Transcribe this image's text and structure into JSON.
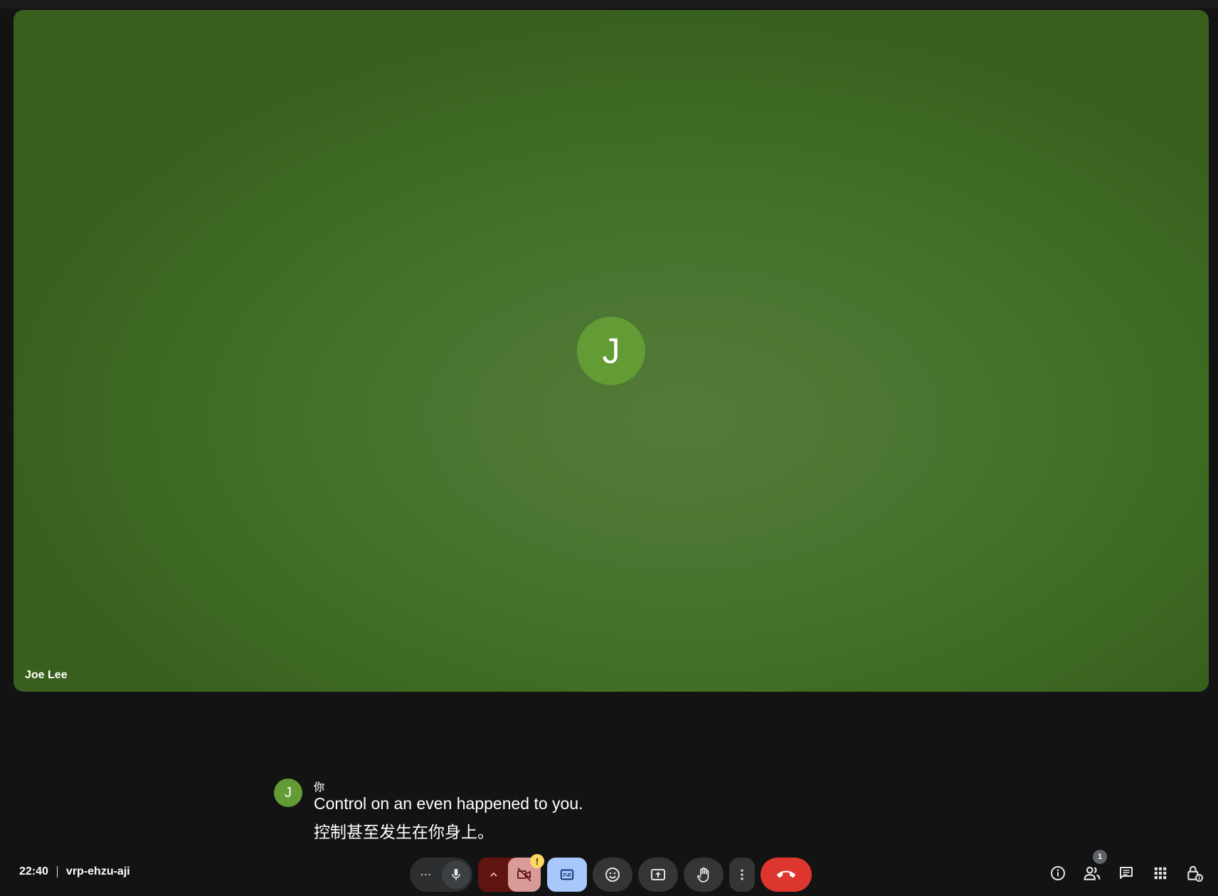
{
  "stage": {
    "participant_name": "Joe Lee",
    "avatar_initial": "J",
    "background_color": "#4a7530"
  },
  "caption": {
    "avatar_initial": "J",
    "speaker": "你",
    "line1": "Control on an even happened to you.",
    "line2": "控制甚至发生在你身上。"
  },
  "meeting": {
    "time": "22:40",
    "code": "vrp-ehzu-aji"
  },
  "controls": {
    "more_audio_label": "⋯",
    "cam_badge": "!",
    "icons": [
      "microphone-icon",
      "chevron-up-icon",
      "camera-off-icon",
      "captions-icon",
      "emoji-icon",
      "present-icon",
      "raise-hand-icon",
      "more-vert-icon",
      "end-call-icon"
    ],
    "colors": {
      "end_call": "#dc362e",
      "captions_active": "#a8c7fa",
      "camera_off": "#d99b99",
      "warning": "#fdd663"
    }
  },
  "side_controls": {
    "people_count": "1",
    "icons": [
      "info-icon",
      "people-icon",
      "chat-icon",
      "apps-icon",
      "host-controls-icon"
    ]
  }
}
